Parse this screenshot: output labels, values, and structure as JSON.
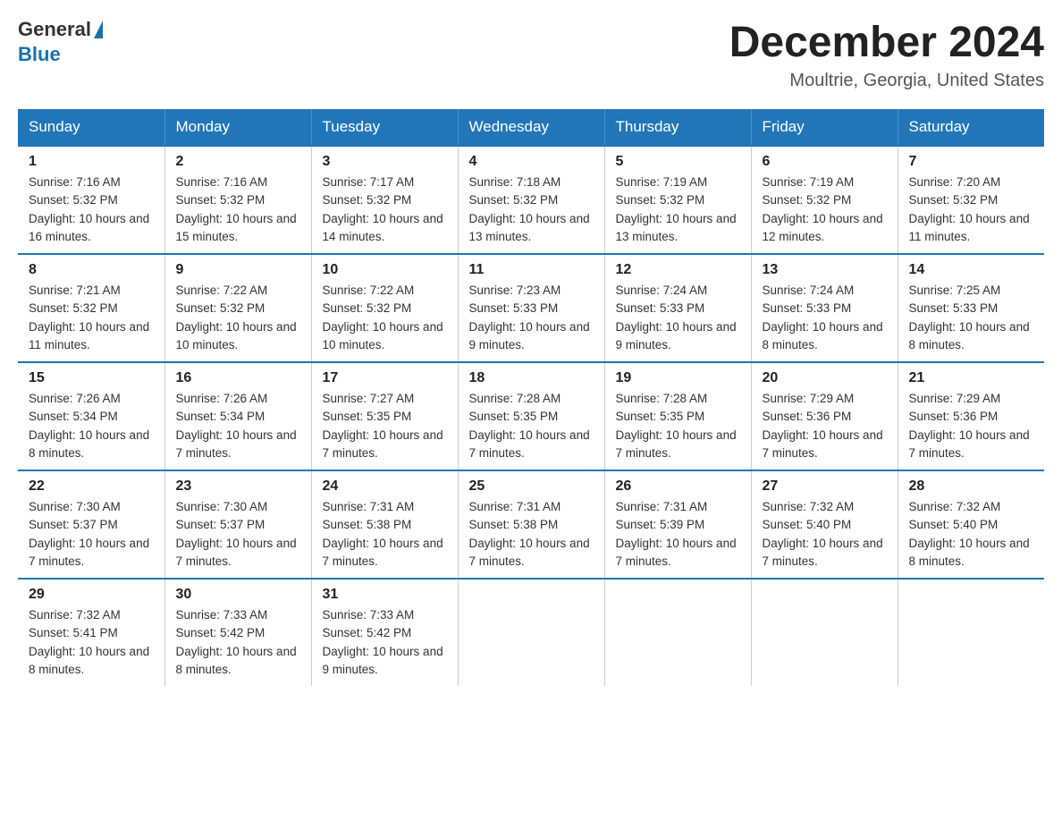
{
  "logo": {
    "general": "General",
    "blue": "Blue"
  },
  "title": "December 2024",
  "location": "Moultrie, Georgia, United States",
  "days": [
    "Sunday",
    "Monday",
    "Tuesday",
    "Wednesday",
    "Thursday",
    "Friday",
    "Saturday"
  ],
  "weeks": [
    [
      {
        "num": "1",
        "sunrise": "7:16 AM",
        "sunset": "5:32 PM",
        "daylight": "10 hours and 16 minutes."
      },
      {
        "num": "2",
        "sunrise": "7:16 AM",
        "sunset": "5:32 PM",
        "daylight": "10 hours and 15 minutes."
      },
      {
        "num": "3",
        "sunrise": "7:17 AM",
        "sunset": "5:32 PM",
        "daylight": "10 hours and 14 minutes."
      },
      {
        "num": "4",
        "sunrise": "7:18 AM",
        "sunset": "5:32 PM",
        "daylight": "10 hours and 13 minutes."
      },
      {
        "num": "5",
        "sunrise": "7:19 AM",
        "sunset": "5:32 PM",
        "daylight": "10 hours and 13 minutes."
      },
      {
        "num": "6",
        "sunrise": "7:19 AM",
        "sunset": "5:32 PM",
        "daylight": "10 hours and 12 minutes."
      },
      {
        "num": "7",
        "sunrise": "7:20 AM",
        "sunset": "5:32 PM",
        "daylight": "10 hours and 11 minutes."
      }
    ],
    [
      {
        "num": "8",
        "sunrise": "7:21 AM",
        "sunset": "5:32 PM",
        "daylight": "10 hours and 11 minutes."
      },
      {
        "num": "9",
        "sunrise": "7:22 AM",
        "sunset": "5:32 PM",
        "daylight": "10 hours and 10 minutes."
      },
      {
        "num": "10",
        "sunrise": "7:22 AM",
        "sunset": "5:32 PM",
        "daylight": "10 hours and 10 minutes."
      },
      {
        "num": "11",
        "sunrise": "7:23 AM",
        "sunset": "5:33 PM",
        "daylight": "10 hours and 9 minutes."
      },
      {
        "num": "12",
        "sunrise": "7:24 AM",
        "sunset": "5:33 PM",
        "daylight": "10 hours and 9 minutes."
      },
      {
        "num": "13",
        "sunrise": "7:24 AM",
        "sunset": "5:33 PM",
        "daylight": "10 hours and 8 minutes."
      },
      {
        "num": "14",
        "sunrise": "7:25 AM",
        "sunset": "5:33 PM",
        "daylight": "10 hours and 8 minutes."
      }
    ],
    [
      {
        "num": "15",
        "sunrise": "7:26 AM",
        "sunset": "5:34 PM",
        "daylight": "10 hours and 8 minutes."
      },
      {
        "num": "16",
        "sunrise": "7:26 AM",
        "sunset": "5:34 PM",
        "daylight": "10 hours and 7 minutes."
      },
      {
        "num": "17",
        "sunrise": "7:27 AM",
        "sunset": "5:35 PM",
        "daylight": "10 hours and 7 minutes."
      },
      {
        "num": "18",
        "sunrise": "7:28 AM",
        "sunset": "5:35 PM",
        "daylight": "10 hours and 7 minutes."
      },
      {
        "num": "19",
        "sunrise": "7:28 AM",
        "sunset": "5:35 PM",
        "daylight": "10 hours and 7 minutes."
      },
      {
        "num": "20",
        "sunrise": "7:29 AM",
        "sunset": "5:36 PM",
        "daylight": "10 hours and 7 minutes."
      },
      {
        "num": "21",
        "sunrise": "7:29 AM",
        "sunset": "5:36 PM",
        "daylight": "10 hours and 7 minutes."
      }
    ],
    [
      {
        "num": "22",
        "sunrise": "7:30 AM",
        "sunset": "5:37 PM",
        "daylight": "10 hours and 7 minutes."
      },
      {
        "num": "23",
        "sunrise": "7:30 AM",
        "sunset": "5:37 PM",
        "daylight": "10 hours and 7 minutes."
      },
      {
        "num": "24",
        "sunrise": "7:31 AM",
        "sunset": "5:38 PM",
        "daylight": "10 hours and 7 minutes."
      },
      {
        "num": "25",
        "sunrise": "7:31 AM",
        "sunset": "5:38 PM",
        "daylight": "10 hours and 7 minutes."
      },
      {
        "num": "26",
        "sunrise": "7:31 AM",
        "sunset": "5:39 PM",
        "daylight": "10 hours and 7 minutes."
      },
      {
        "num": "27",
        "sunrise": "7:32 AM",
        "sunset": "5:40 PM",
        "daylight": "10 hours and 7 minutes."
      },
      {
        "num": "28",
        "sunrise": "7:32 AM",
        "sunset": "5:40 PM",
        "daylight": "10 hours and 8 minutes."
      }
    ],
    [
      {
        "num": "29",
        "sunrise": "7:32 AM",
        "sunset": "5:41 PM",
        "daylight": "10 hours and 8 minutes."
      },
      {
        "num": "30",
        "sunrise": "7:33 AM",
        "sunset": "5:42 PM",
        "daylight": "10 hours and 8 minutes."
      },
      {
        "num": "31",
        "sunrise": "7:33 AM",
        "sunset": "5:42 PM",
        "daylight": "10 hours and 9 minutes."
      },
      null,
      null,
      null,
      null
    ]
  ],
  "labels": {
    "sunrise": "Sunrise:",
    "sunset": "Sunset:",
    "daylight": "Daylight:"
  }
}
